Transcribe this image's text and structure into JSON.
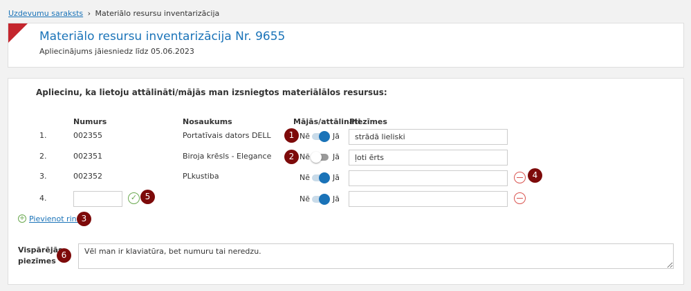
{
  "breadcrumb": {
    "link": "Uzdevumu saraksts",
    "sep": "›",
    "current": "Materiālo resursu inventarizācija"
  },
  "header": {
    "title": "Materiālo resursu inventarizācija Nr. 9655",
    "subtitle": "Apliecinājums jāiesniedz līdz 05.06.2023"
  },
  "form": {
    "intro": "Apliecinu, ka lietoju attālināti/mājās man izsniegtos materiālālos resursus:",
    "columns": {
      "number": "Numurs",
      "name": "Nosaukums",
      "remote": "Mājās/attālināti",
      "notes": "Piezīmes"
    },
    "toggle_no": "Nē",
    "toggle_yes": "Jā",
    "rows": [
      {
        "index": "1.",
        "number": "002355",
        "name": "Portatīvais dators DELL",
        "remote": true,
        "notes": "strādā lieliski"
      },
      {
        "index": "2.",
        "number": "002351",
        "name": "Biroja krēsls - Elegance",
        "remote": false,
        "notes": "ļoti ērts"
      },
      {
        "index": "3.",
        "number": "002352",
        "name": "PLkustiba",
        "remote": true,
        "notes": ""
      },
      {
        "index": "4.",
        "number": "",
        "name": "",
        "remote": true,
        "notes": ""
      }
    ],
    "add_row": "Pievienot rindu",
    "general_notes_label": "Vispārējās piezīmes",
    "general_notes": "Vēl man ir klaviatūra, bet numuru tai neredzu."
  },
  "badges": [
    "1",
    "2",
    "3",
    "4",
    "5",
    "6"
  ]
}
